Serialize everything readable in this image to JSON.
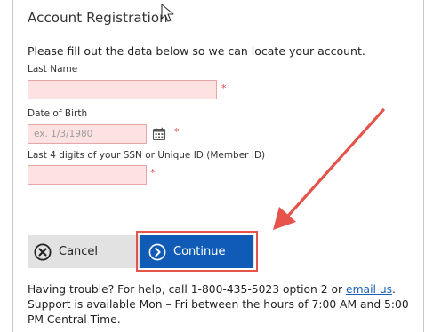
{
  "form": {
    "title": "Account Registration",
    "instructions": "Please fill out the data below so we can locate your account.",
    "required_marker": "*",
    "last_name": {
      "label": "Last Name",
      "value": "",
      "placeholder": ""
    },
    "dob": {
      "label": "Date of Birth",
      "value": "",
      "placeholder": "ex. 1/3/1980"
    },
    "ssn": {
      "label": "Last 4 digits of your SSN or Unique ID (Member ID)",
      "value": "",
      "placeholder": ""
    }
  },
  "buttons": {
    "cancel_label": "Cancel",
    "continue_label": "Continue"
  },
  "help": {
    "prefix": "Having trouble? For help, call 1-800-435-5023 option 2 or ",
    "link_text": "email us",
    "suffix": ". Support is available Mon – Fri between the hours of 7:00 AM and 5:00 PM Central Time."
  },
  "colors": {
    "accent": "#0f5bb6",
    "field_bg": "#fde2e2",
    "field_border": "#e8a7a7",
    "required": "#e04545",
    "annotation": "#e5534b",
    "button_bar": "#e2e2e2"
  },
  "icons": {
    "calendar": "calendar-icon",
    "cancel": "close-circle-icon",
    "continue": "chevron-right-circle-icon",
    "cursor": "mouse-pointer-icon"
  }
}
